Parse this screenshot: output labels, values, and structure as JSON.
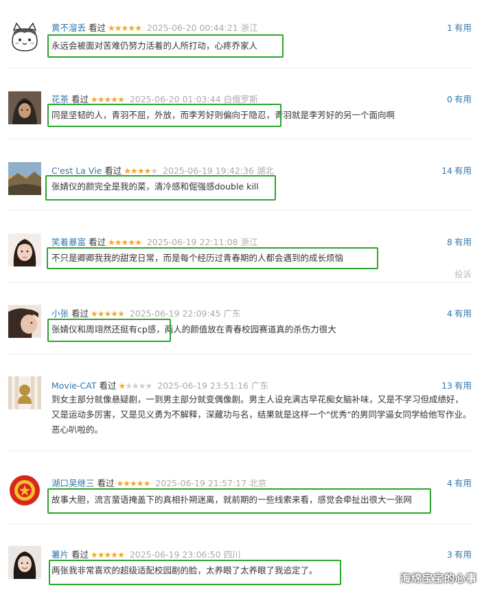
{
  "vote_label": "有用",
  "seen_label": "看过",
  "report_label": "投诉",
  "watermark": "海绵宝宝的心事",
  "colors": {
    "link": "#3377aa",
    "star": "#f5a623",
    "highlight_box": "#2aa52a",
    "meta": "#aaaaaa"
  },
  "comments": [
    {
      "user": "黄不溜丢",
      "rating": 5,
      "time": "2025-06-20 00:44:21",
      "region": "浙江",
      "votes": "1",
      "text": "永远会被面对苦难仍努力活着的人所打动，心疼乔家人",
      "avatar": "cartoon-cat-avatar"
    },
    {
      "user": "花茶",
      "rating": 5,
      "time": "2025-06-20 01:03:44",
      "region": "白俄罗斯",
      "votes": "0",
      "text": "同是坚韧的人，青羽不屈，外放，而李芳好则偏向于隐忍，青羽就是李芳好的另一个面向啊",
      "avatar": "hooded-person-avatar"
    },
    {
      "user": "C'est La Vie",
      "rating": 4,
      "time": "2025-06-19 19:42:36",
      "region": "湖北",
      "votes": "14",
      "text": "张婧仪的颜完全是我的菜，清冷感和倔强感double kill",
      "avatar": "landscape-avatar"
    },
    {
      "user": "笑着暴富",
      "rating": 5,
      "time": "2025-06-19 22:11:08",
      "region": "浙江",
      "votes": "8",
      "text": "不只是卿卿我我的甜宠日常，而是每个经历过青春期的人都会遇到的成长烦恼",
      "avatar": "girl-portrait-avatar"
    },
    {
      "user": "小张",
      "rating": 5,
      "time": "2025-06-19 22:09:45",
      "region": "广东",
      "votes": "4",
      "text": "张婧仪和周翊然还挺有cp感，两人的颜值放在青春校园赛道真的杀伤力很大",
      "avatar": "woman-profile-avatar"
    },
    {
      "user": "Movie-CAT",
      "rating": 1,
      "time": "2025-06-19 23:51:16",
      "region": "广东",
      "votes": "13",
      "text": "到女主部分就像悬疑剧，一到男主部分就变偶像剧。男主人设充满古早花痴女脑补味，又是不学习但成绩好，又是运动多厉害，又是见义勇为不解释，深藏功与名，结果就是这样一个\"优秀\"的男同学逼女同学给他写作业。恶心叭啦的。",
      "avatar": "silhouette-avatar"
    },
    {
      "user": "湖口吴继三",
      "rating": 5,
      "time": "2025-06-19 21:57:17",
      "region": "北京",
      "votes": "4",
      "text": "故事大胆，流言蜚语掩盖下的真相扑朔迷离，就前期的一些线索来看，感觉会牵扯出很大一张网",
      "avatar": "red-emblem-avatar"
    },
    {
      "user": "薯片",
      "rating": 5,
      "time": "2025-06-19 23:06:50",
      "region": "四川",
      "votes": "3",
      "text": "两张我非常喜欢的超级适配校园剧的脸，太养眼了太养眼了我追定了。",
      "avatar": "girl-smile-avatar"
    }
  ]
}
